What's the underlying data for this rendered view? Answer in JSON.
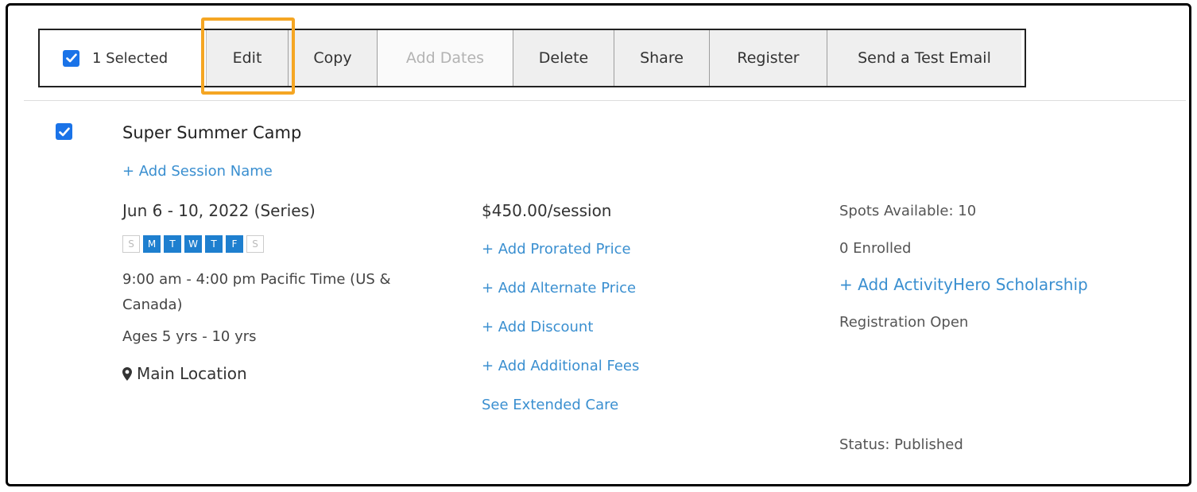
{
  "toolbar": {
    "selected_label": "1 Selected",
    "buttons": [
      {
        "label": "Edit",
        "enabled": true
      },
      {
        "label": "Copy",
        "enabled": true
      },
      {
        "label": "Add Dates",
        "enabled": false
      },
      {
        "label": "Delete",
        "enabled": true
      },
      {
        "label": "Share",
        "enabled": true
      },
      {
        "label": "Register",
        "enabled": true
      },
      {
        "label": "Send a Test Email",
        "enabled": true
      }
    ]
  },
  "session": {
    "title": "Super Summer Camp",
    "add_session_name": "+ Add Session Name",
    "dates": "Jun 6 - 10, 2022 (Series)",
    "days": [
      {
        "label": "S",
        "active": false
      },
      {
        "label": "M",
        "active": true
      },
      {
        "label": "T",
        "active": true
      },
      {
        "label": "W",
        "active": true
      },
      {
        "label": "T",
        "active": true
      },
      {
        "label": "F",
        "active": true
      },
      {
        "label": "S",
        "active": false
      }
    ],
    "time": "9:00 am - 4:00 pm Pacific Time (US & Canada)",
    "ages": "Ages 5 yrs - 10 yrs",
    "location": "Main Location",
    "price": "$450.00/session",
    "price_links": {
      "prorated": "+ Add Prorated Price",
      "alternate": "+ Add Alternate Price",
      "discount": "+ Add Discount",
      "fees": "+ Add Additional Fees",
      "extended_care": "See Extended Care"
    },
    "spots": "Spots Available: 10",
    "enrolled": "0 Enrolled",
    "scholarship": "+ Add ActivityHero Scholarship",
    "registration": "Registration Open",
    "status": "Status: Published"
  },
  "colors": {
    "accent": "#1a73e8",
    "link": "#3a8fd0",
    "highlight": "#f5a623",
    "day_active": "#1e7fcf"
  }
}
